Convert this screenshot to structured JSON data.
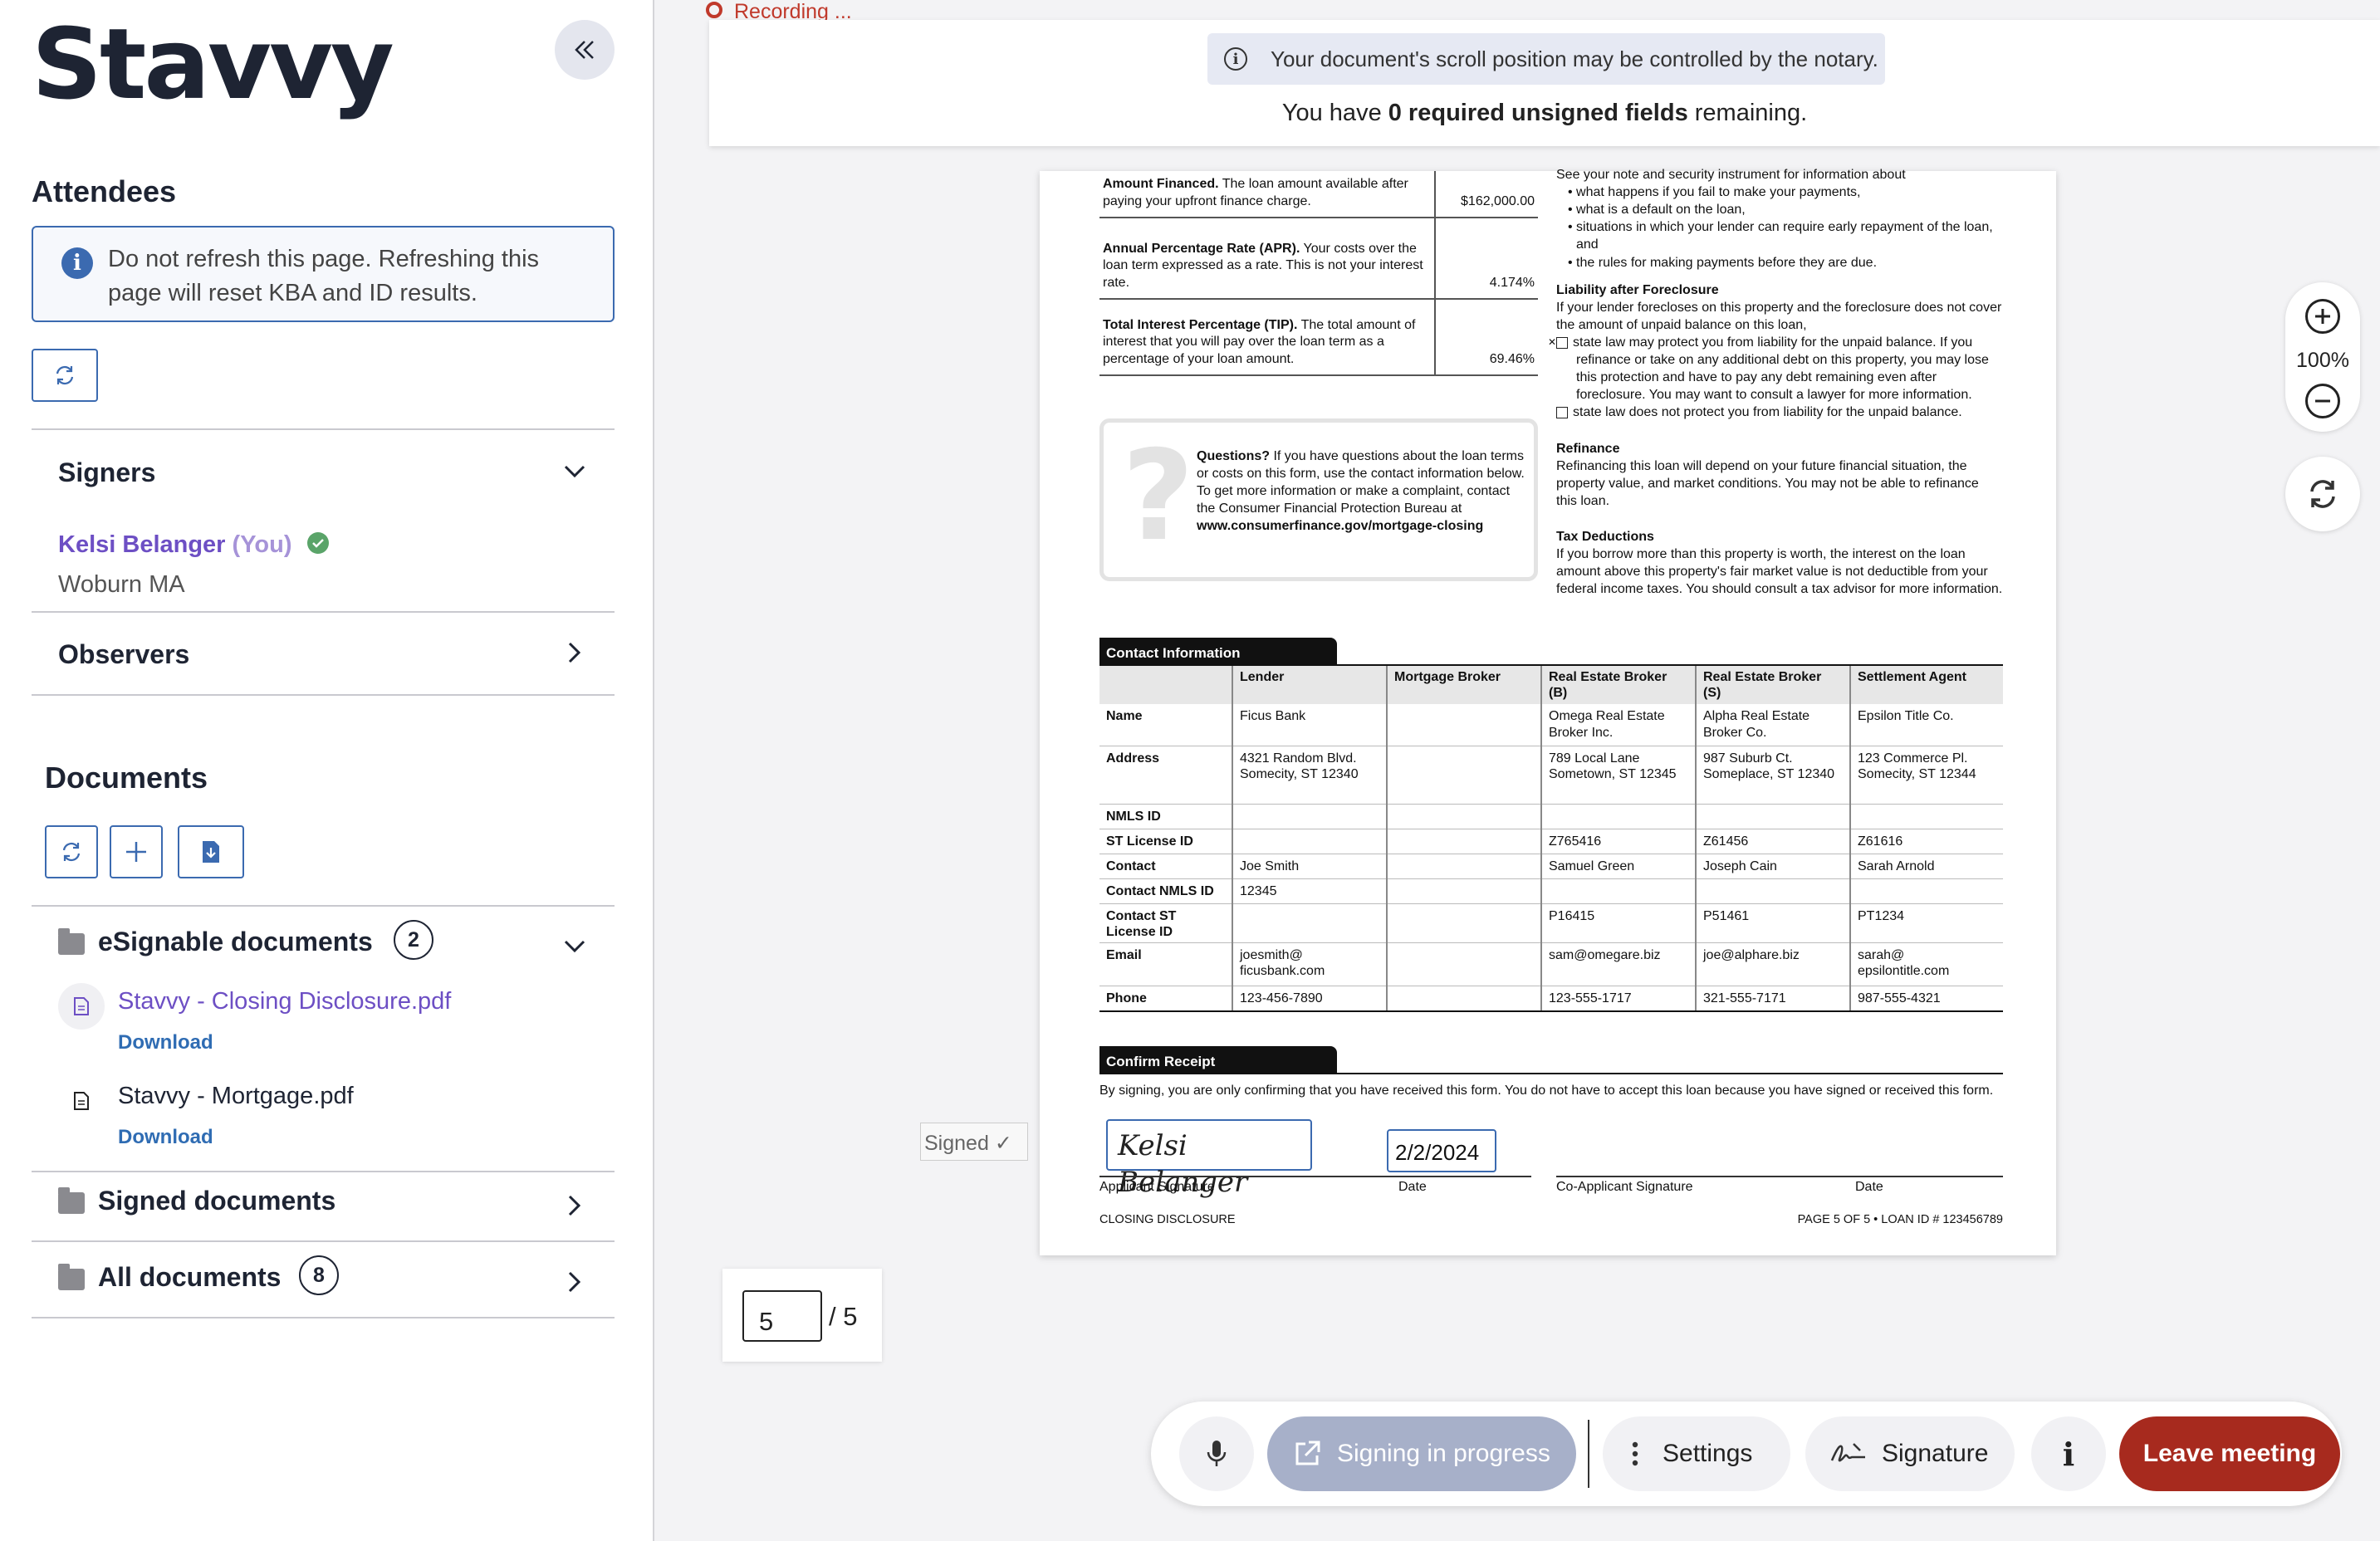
{
  "app": {
    "logo": "Stavvy"
  },
  "sidebar": {
    "attendees_title": "Attendees",
    "refresh_notice": "Do not refresh this page. Refreshing this page will reset KBA and ID results.",
    "signers": {
      "title": "Signers",
      "name": "Kelsi Belanger",
      "you": "(You)",
      "location": "Woburn MA"
    },
    "observers_title": "Observers",
    "documents_title": "Documents",
    "esignable": {
      "title": "eSignable documents",
      "count": "2",
      "docs": [
        {
          "name": "Stavvy - Closing Disclosure.pdf",
          "download": "Download"
        },
        {
          "name": "Stavvy - Mortgage.pdf",
          "download": "Download"
        }
      ]
    },
    "signed": {
      "title": "Signed documents"
    },
    "all": {
      "title": "All documents",
      "count": "8"
    }
  },
  "main": {
    "recording": "Recording ...",
    "scroll_notice": "Your document's scroll position may be controlled by the notary.",
    "remaining_prefix": "You have ",
    "remaining_count": "0 required unsigned fields",
    "remaining_suffix": " remaining.",
    "signed_tag": "Signed",
    "page_current": "5",
    "page_total": "/ 5",
    "zoom": "100%",
    "toolbar": {
      "signing": "Signing in progress",
      "settings": "Settings",
      "signature": "Signature",
      "info": "i",
      "leave": "Leave meeting"
    }
  },
  "document": {
    "loan_rows": [
      {
        "label": "Amount Financed.",
        "text": " The loan amount available after paying your upfront finance charge.",
        "value": "$162,000.00"
      },
      {
        "label": "Annual Percentage Rate (APR).",
        "text": " Your costs over the loan term expressed as a rate. This is not your interest rate.",
        "value": "4.174%"
      },
      {
        "label": "Total Interest Percentage (TIP).",
        "text": " The total amount of interest that you will pay over the loan term as a percentage of your loan amount.",
        "value": "69.46%"
      }
    ],
    "right_intro": "See your note and security instrument for information about",
    "right_bullets": [
      "• what happens if you fail to make your payments,",
      "• what is a default on the loan,",
      "• situations in which your lender can require early repayment of the loan, and",
      "• the rules for making payments before they are due."
    ],
    "liability_title": "Liability after Foreclosure",
    "liability_text": "If your lender forecloses on this property and the foreclosure does not cover the amount of unpaid balance on this loan,",
    "liability_opt1": "state law may protect you from liability for the unpaid balance. If you refinance or take on any additional debt on this property, you may lose this protection and have to pay any debt remaining even after foreclosure. You may want to consult a lawyer for more information.",
    "liability_opt2": "state law does not protect you from liability for the unpaid balance.",
    "refinance_title": "Refinance",
    "refinance_text": "Refinancing this loan will depend on your future financial situation, the property value, and market conditions. You may not be able to refinance this loan.",
    "tax_title": "Tax Deductions",
    "tax_text": "If you borrow more than this property is worth, the interest on the loan amount above this property's fair market value is not deductible from your federal income taxes. You should consult a tax advisor for more information.",
    "questions_bold": "Questions?",
    "questions_text": " If you have questions about the loan terms or costs on this form, use the contact information below. To get more information or make a complaint, contact the Consumer Financial Protection Bureau at",
    "questions_url": "www.consumerfinance.gov/mortgage-closing",
    "contact_title": "Contact Information",
    "contact_headers": [
      "",
      "Lender",
      "Mortgage Broker",
      "Real Estate Broker (B)",
      "Real Estate Broker (S)",
      "Settlement Agent"
    ],
    "contact_rows": [
      [
        "Name",
        "Ficus Bank",
        "",
        "Omega Real Estate Broker Inc.",
        "Alpha Real Estate Broker Co.",
        "Epsilon Title Co."
      ],
      [
        "Address",
        "4321 Random Blvd. Somecity, ST 12340",
        "",
        "789 Local Lane Sometown, ST 12345",
        "987 Suburb Ct. Someplace, ST 12340",
        "123 Commerce Pl. Somecity, ST 12344"
      ],
      [
        "NMLS ID",
        "",
        "",
        "",
        "",
        ""
      ],
      [
        "ST License ID",
        "",
        "",
        "Z765416",
        "Z61456",
        "Z61616"
      ],
      [
        "Contact",
        "Joe Smith",
        "",
        "Samuel Green",
        "Joseph Cain",
        "Sarah Arnold"
      ],
      [
        "Contact NMLS ID",
        "12345",
        "",
        "",
        "",
        ""
      ],
      [
        "Contact ST License ID",
        "",
        "",
        "P16415",
        "P51461",
        "PT1234"
      ],
      [
        "Email",
        "joesmith@ ficusbank.com",
        "",
        "sam@omegare.biz",
        "joe@alphare.biz",
        "sarah@ epsilontitle.com"
      ],
      [
        "Phone",
        "123-456-7890",
        "",
        "123-555-1717",
        "321-555-7171",
        "987-555-4321"
      ]
    ],
    "confirm_title": "Confirm Receipt",
    "confirm_text": "By signing, you are only confirming that you have received this form. You do not have to accept this loan because you have signed or received this form.",
    "signature": "Kelsi Belanger",
    "date_value": "2/2/2024",
    "sig_labels": {
      "applicant": "Applicant Signature",
      "date1": "Date",
      "co_applicant": "Co-Applicant Signature",
      "date2": "Date"
    },
    "footer_left": "CLOSING DISCLOSURE",
    "footer_right": "PAGE 5 OF 5 • LOAN ID # 123456789"
  }
}
